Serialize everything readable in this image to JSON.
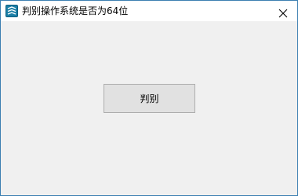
{
  "window": {
    "title": "判别操作系统是否为64位",
    "icon": "app-icon",
    "close_icon": "close-icon",
    "accent_color": "#3c7fb1"
  },
  "main": {
    "button_label": "判别"
  }
}
